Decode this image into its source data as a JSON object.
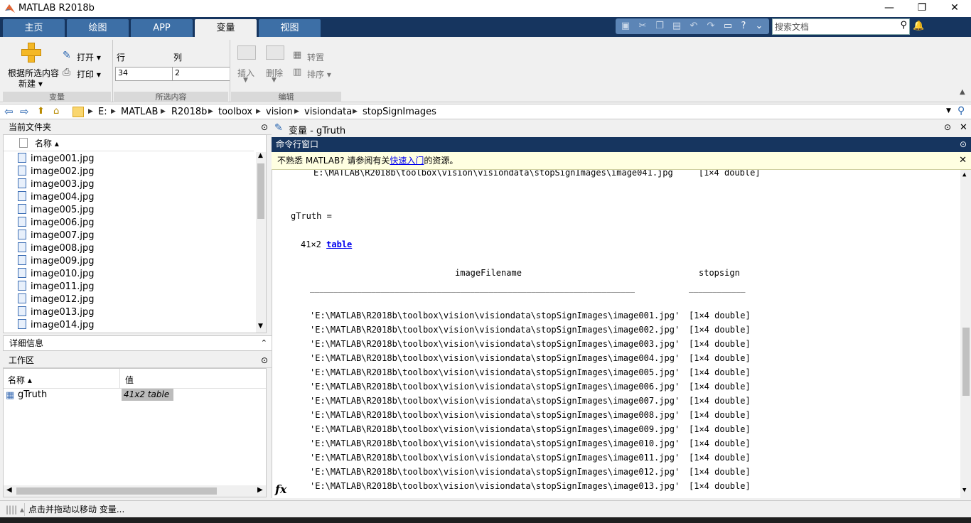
{
  "window": {
    "title": "MATLAB R2018b",
    "minimize": "—",
    "restore": "❐",
    "close": "✕"
  },
  "tabs": [
    {
      "label": "主页"
    },
    {
      "label": "绘图"
    },
    {
      "label": "APP"
    },
    {
      "label": "变量"
    },
    {
      "label": "视图"
    }
  ],
  "quick_access": {
    "search_placeholder": "搜索文档"
  },
  "toolstrip": {
    "new_from_selection": "根据所选内容",
    "new_label": "新建 ▾",
    "open": "打开 ▾",
    "print": "打印 ▾",
    "row_label": "行",
    "col_label": "列",
    "row_value": "34",
    "col_value": "2",
    "insert": "插入",
    "delete": "删除",
    "transpose": "转置",
    "sort": "排序 ▾",
    "group_variable": "变量",
    "group_selection": "所选内容",
    "group_edit": "编辑"
  },
  "address": {
    "parts": [
      "E:",
      "MATLAB",
      "R2018b",
      "toolbox",
      "vision",
      "visiondata",
      "stopSignImages"
    ]
  },
  "current_folder": {
    "title": "当前文件夹",
    "column_name": "名称 ▴",
    "files": [
      "image001.jpg",
      "image002.jpg",
      "image003.jpg",
      "image004.jpg",
      "image005.jpg",
      "image006.jpg",
      "image007.jpg",
      "image008.jpg",
      "image009.jpg",
      "image010.jpg",
      "image011.jpg",
      "image012.jpg",
      "image013.jpg",
      "image014.jpg"
    ]
  },
  "details": {
    "title": "详细信息"
  },
  "workspace": {
    "title": "工作区",
    "col_name": "名称 ▴",
    "col_value": "值",
    "var_name": "gTruth",
    "var_value": "41x2 table"
  },
  "variable_editor": {
    "title": "变量 - gTruth"
  },
  "command_window": {
    "title": "命令行窗口",
    "tip_prefix": "不熟悉 MATLAB? 请参阅有关",
    "tip_link": "快速入门",
    "tip_suffix": "的资源。",
    "top_line": "E:\\MATLAB\\R2018b\\toolbox\\vision\\visiondata\\stopSignImages\\image041.jpg     [1×4 double]",
    "assign": "gTruth =",
    "size_text": "41×2",
    "size_link": "table",
    "col1": "imageFilename",
    "col2": "stopsign",
    "rule1": "_____________________________________________________________________",
    "rule2": "____________",
    "rows": [
      {
        "file": "'E:\\MATLAB\\R2018b\\toolbox\\vision\\visiondata\\stopSignImages\\image001.jpg'",
        "val": "[1×4 double]"
      },
      {
        "file": "'E:\\MATLAB\\R2018b\\toolbox\\vision\\visiondata\\stopSignImages\\image002.jpg'",
        "val": "[1×4 double]"
      },
      {
        "file": "'E:\\MATLAB\\R2018b\\toolbox\\vision\\visiondata\\stopSignImages\\image003.jpg'",
        "val": "[1×4 double]"
      },
      {
        "file": "'E:\\MATLAB\\R2018b\\toolbox\\vision\\visiondata\\stopSignImages\\image004.jpg'",
        "val": "[1×4 double]"
      },
      {
        "file": "'E:\\MATLAB\\R2018b\\toolbox\\vision\\visiondata\\stopSignImages\\image005.jpg'",
        "val": "[1×4 double]"
      },
      {
        "file": "'E:\\MATLAB\\R2018b\\toolbox\\vision\\visiondata\\stopSignImages\\image006.jpg'",
        "val": "[1×4 double]"
      },
      {
        "file": "'E:\\MATLAB\\R2018b\\toolbox\\vision\\visiondata\\stopSignImages\\image007.jpg'",
        "val": "[1×4 double]"
      },
      {
        "file": "'E:\\MATLAB\\R2018b\\toolbox\\vision\\visiondata\\stopSignImages\\image008.jpg'",
        "val": "[1×4 double]"
      },
      {
        "file": "'E:\\MATLAB\\R2018b\\toolbox\\vision\\visiondata\\stopSignImages\\image009.jpg'",
        "val": "[1×4 double]"
      },
      {
        "file": "'E:\\MATLAB\\R2018b\\toolbox\\vision\\visiondata\\stopSignImages\\image010.jpg'",
        "val": "[1×4 double]"
      },
      {
        "file": "'E:\\MATLAB\\R2018b\\toolbox\\vision\\visiondata\\stopSignImages\\image011.jpg'",
        "val": "[1×4 double]"
      },
      {
        "file": "'E:\\MATLAB\\R2018b\\toolbox\\vision\\visiondata\\stopSignImages\\image012.jpg'",
        "val": "[1×4 double]"
      },
      {
        "file": "'E:\\MATLAB\\R2018b\\toolbox\\vision\\visiondata\\stopSignImages\\image013.jpg'",
        "val": "[1×4 double]"
      }
    ],
    "prompt": "fx"
  },
  "status": {
    "text": "点击并拖动以移动 变量..."
  },
  "colors": {
    "tab_bar": "#16355f",
    "tab": "#3d6fa6",
    "tip_bg": "#ffffe1",
    "link": "#0000ee"
  }
}
